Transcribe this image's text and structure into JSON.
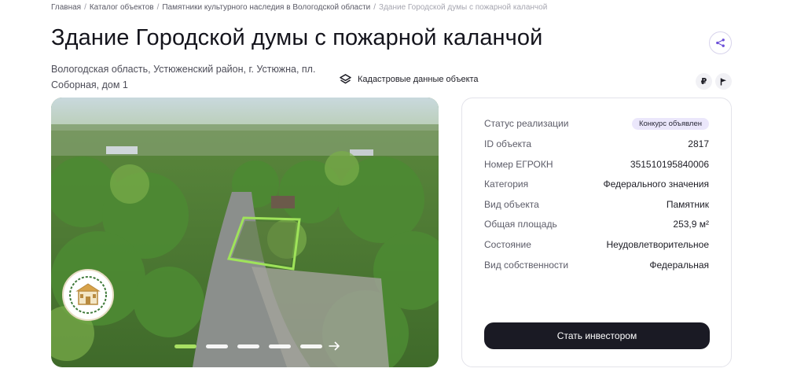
{
  "breadcrumb": {
    "items": [
      "Главная",
      "Каталог объектов",
      "Памятники культурного наследия в Вологодской области",
      "Здание Городской думы с пожарной каланчой"
    ]
  },
  "title": "Здание Городской думы с пожарной каланчой",
  "address": "Вологодская область, Устюженский район, г. Устюжна, пл. Соборная, дом 1",
  "cadastral_link": "Кадастровые данные объекта",
  "icons": {
    "share": "share-icon",
    "cadastral": "layers-icon",
    "ruble": "₽",
    "flag": "flag-icon",
    "arrow": "arrow-right-icon"
  },
  "gallery": {
    "slide_count": 5,
    "active_slide": 1
  },
  "info": {
    "rows": [
      {
        "key": "Статус реализации",
        "value": "Конкурс объявлен"
      },
      {
        "key": "ID объекта",
        "value": "2817"
      },
      {
        "key": "Номер ЕГРОКН",
        "value": "351510195840006"
      },
      {
        "key": "Категория",
        "value": "Федерального значения"
      },
      {
        "key": "Вид объекта",
        "value": "Памятник"
      },
      {
        "key": "Общая площадь",
        "value": "253,9 м²"
      },
      {
        "key": "Состояние",
        "value": "Неудовлетворительное"
      },
      {
        "key": "Вид собственности",
        "value": "Федеральная"
      }
    ],
    "button_label": "Стать инвестором"
  },
  "colors": {
    "accent_green": "#a8e063",
    "pill_bg": "#ebe7fb",
    "button_bg": "#1a1a24"
  }
}
